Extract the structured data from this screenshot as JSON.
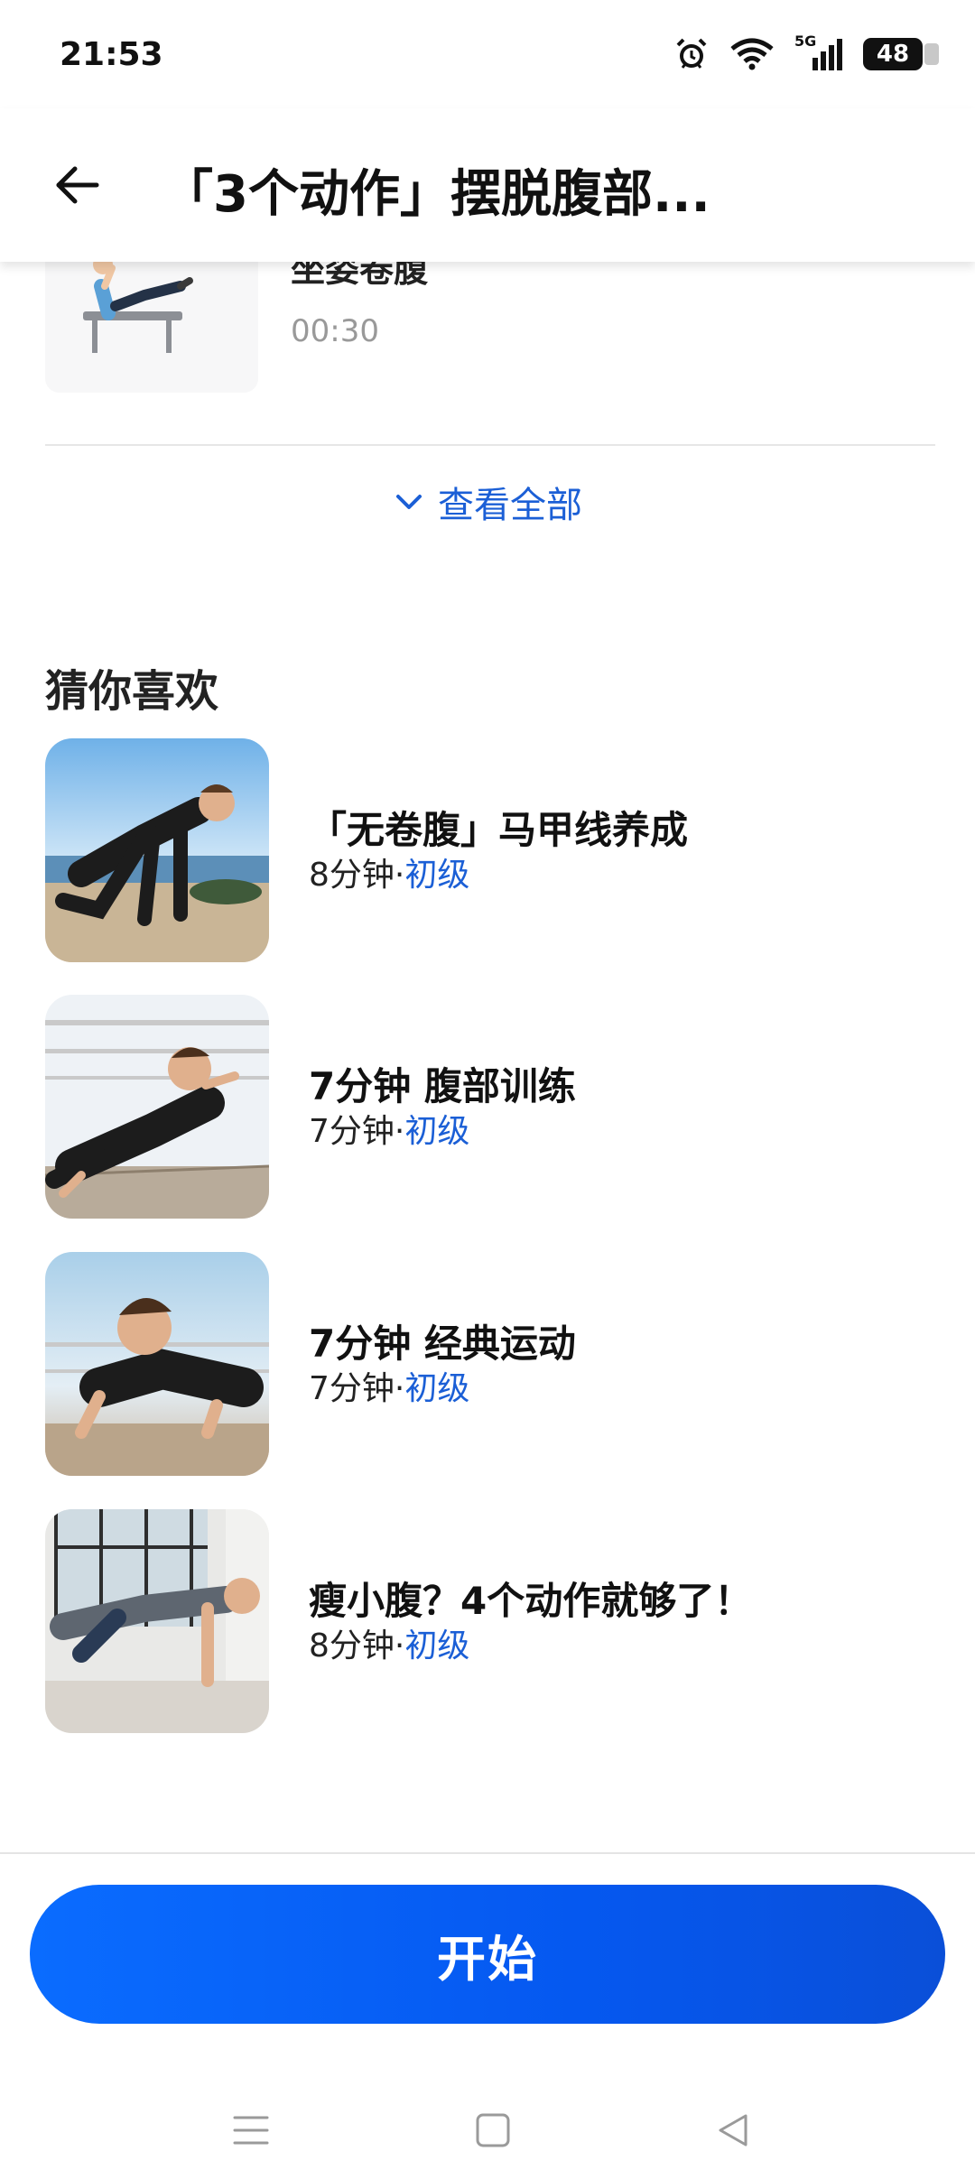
{
  "status_bar": {
    "time": "21:53",
    "network": "5G",
    "battery": "48"
  },
  "header": {
    "title": "「3个动作」摆脱腹部..."
  },
  "exercise": {
    "name": "坐姿卷腹",
    "duration": "00:30"
  },
  "view_all_label": "查看全部",
  "recommendations": {
    "section_title": "猜你喜欢",
    "items": [
      {
        "title": "「无卷腹」马甲线养成",
        "duration": "8分钟",
        "separator": "·",
        "level": "初级"
      },
      {
        "title": "7分钟 腹部训练",
        "duration": "7分钟",
        "separator": "·",
        "level": "初级"
      },
      {
        "title": "7分钟 经典运动",
        "duration": "7分钟",
        "separator": "·",
        "level": "初级"
      },
      {
        "title": "瘦小腹？4个动作就够了！",
        "duration": "8分钟",
        "separator": "·",
        "level": "初级"
      }
    ]
  },
  "start_button_label": "开始",
  "colors": {
    "accent": "#1b5fd6",
    "button": "#0a6cff"
  }
}
